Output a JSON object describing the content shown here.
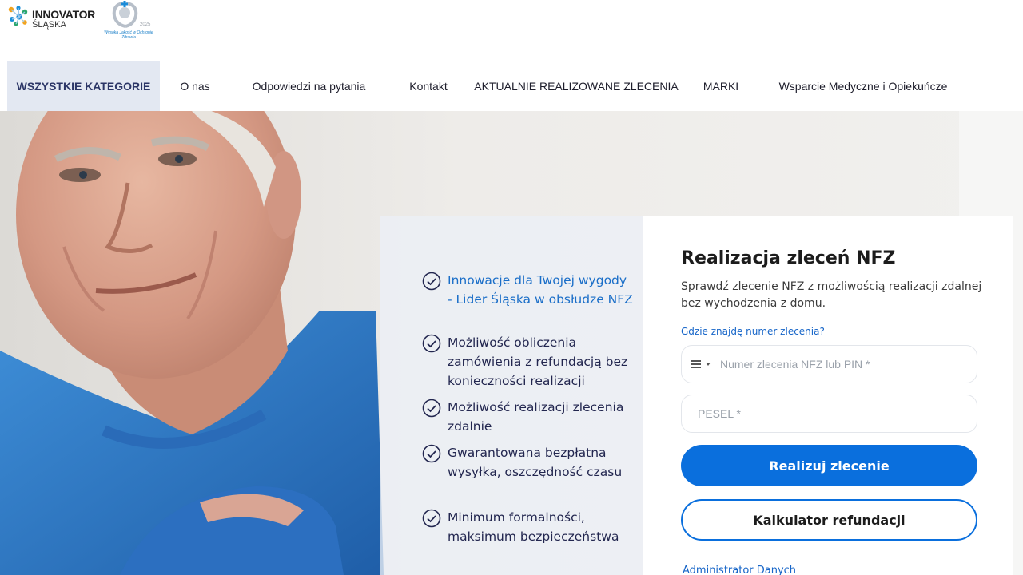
{
  "header": {
    "logo_title": "INNOVATOR",
    "logo_subtitle": "ŚLĄSKA",
    "badge_text": "Wysoka Jakość w Ochronie Zdrowia",
    "badge_year": "2025"
  },
  "nav": {
    "items": [
      {
        "label": "WSZYSTKIE KATEGORIE",
        "active": true
      },
      {
        "label": "O nas"
      },
      {
        "label": "Odpowiedzi na pytania"
      },
      {
        "label": "Kontakt"
      },
      {
        "label": "AKTUALNIE REALIZOWANE ZLECENIA"
      },
      {
        "label": "MARKI"
      },
      {
        "label": "Wsparcie Medyczne i Opiekuńcze"
      }
    ]
  },
  "features": [
    {
      "text": "Innowacje dla Twojej wygody - Lider Śląska w obsłudze NFZ",
      "highlight": true
    },
    {
      "text": "Możliwość obliczenia zamówienia z refundacją bez konieczności realizacji"
    },
    {
      "text": "Możliwość realizacji zlecenia zdalnie"
    },
    {
      "text": "Gwarantowana bezpłatna wysyłka, oszczędność czasu"
    },
    {
      "text": "Minimum formalności, maksimum bezpieczeństwa"
    }
  ],
  "form": {
    "title": "Realizacja zleceń NFZ",
    "description": "Sprawdź zlecenie NFZ z możliwością realizacji zdalnej bez wychodzenia z domu.",
    "help_link": "Gdzie znajdę numer zlecenia?",
    "order_placeholder": "Numer zlecenia NFZ lub PIN *",
    "pesel_placeholder": "PESEL *",
    "submit_label": "Realizuj zlecenie",
    "calculator_label": "Kalkulator refundacji",
    "admin_link": "Administrator Danych"
  },
  "colors": {
    "accent": "#0a6fdd",
    "nav_active_bg": "#e3e8f2",
    "feature_text": "#22264f",
    "feature_highlight": "#1a6ec8"
  },
  "icons": {
    "feature_bullet": "check-circle-icon",
    "order_type": "list-menu-icon"
  }
}
